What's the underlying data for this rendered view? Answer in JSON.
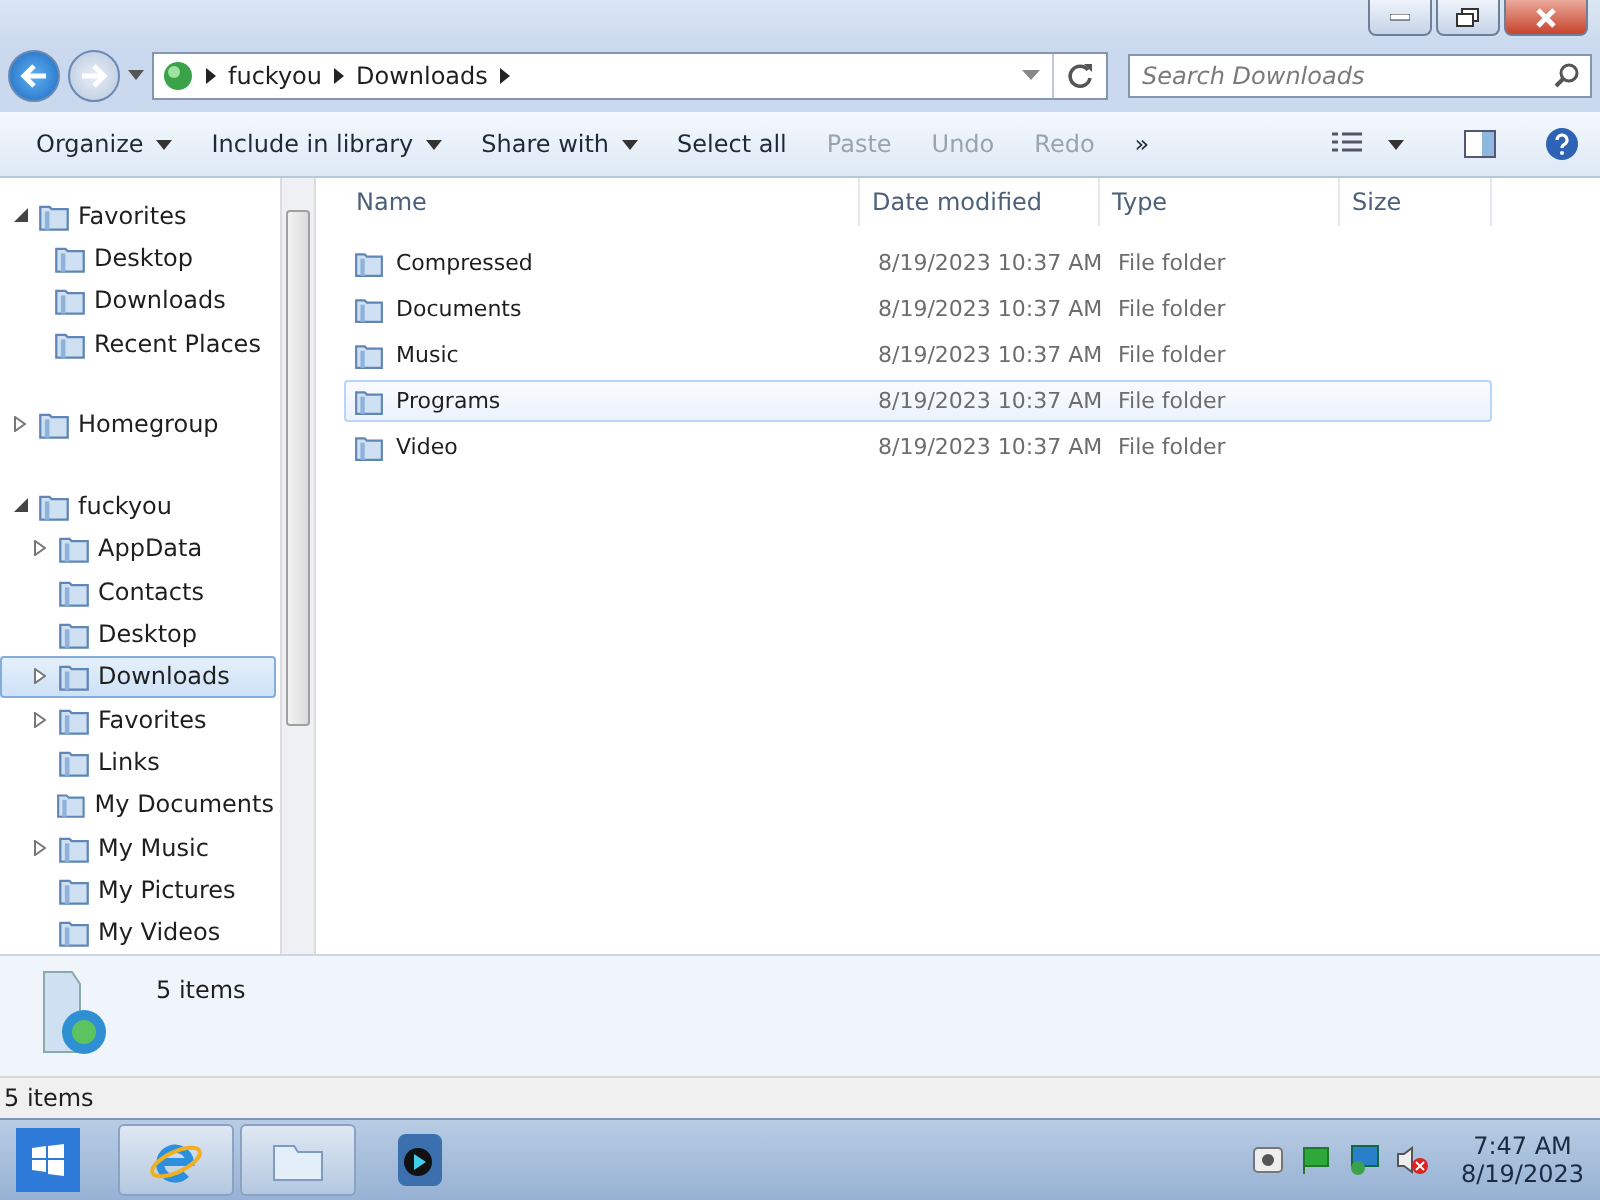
{
  "address_bar": {
    "crumbs": [
      "fuckyou",
      "Downloads"
    ]
  },
  "search": {
    "placeholder": "Search Downloads"
  },
  "toolbar": [
    {
      "label": "Organize",
      "dropdown": true,
      "disabled": false
    },
    {
      "label": "Include in library",
      "dropdown": true,
      "disabled": false
    },
    {
      "label": "Share with",
      "dropdown": true,
      "disabled": false
    },
    {
      "label": "Select all",
      "dropdown": false,
      "disabled": false
    },
    {
      "label": "Paste",
      "dropdown": false,
      "disabled": true
    },
    {
      "label": "Undo",
      "dropdown": false,
      "disabled": true
    },
    {
      "label": "Redo",
      "dropdown": false,
      "disabled": true
    },
    {
      "label": "»",
      "dropdown": false,
      "disabled": false
    }
  ],
  "sidebar": {
    "groups": [
      {
        "label": "Favorites",
        "expanded": true,
        "children": [
          {
            "label": "Desktop"
          },
          {
            "label": "Downloads"
          },
          {
            "label": "Recent Places"
          }
        ]
      },
      {
        "label": "Homegroup",
        "expanded": false
      },
      {
        "label": "fuckyou",
        "expanded": true,
        "children": [
          {
            "label": "AppData",
            "expandable": true,
            "selected": false
          },
          {
            "label": "Contacts",
            "expandable": false,
            "selected": false
          },
          {
            "label": "Desktop",
            "expandable": false,
            "selected": false
          },
          {
            "label": "Downloads",
            "expandable": true,
            "selected": true
          },
          {
            "label": "Favorites",
            "expandable": true,
            "selected": false
          },
          {
            "label": "Links",
            "expandable": false,
            "selected": false
          },
          {
            "label": "My Documents",
            "expandable": false,
            "selected": false
          },
          {
            "label": "My Music",
            "expandable": true,
            "selected": false
          },
          {
            "label": "My Pictures",
            "expandable": false,
            "selected": false
          },
          {
            "label": "My Videos",
            "expandable": false,
            "selected": false
          }
        ]
      }
    ]
  },
  "table": {
    "columns": [
      "Name",
      "Date modified",
      "Type",
      "Size"
    ],
    "rows": [
      {
        "name": "Compressed",
        "date": "8/19/2023 10:37 AM",
        "type": "File folder",
        "hovered": false
      },
      {
        "name": "Documents",
        "date": "8/19/2023 10:37 AM",
        "type": "File folder",
        "hovered": false
      },
      {
        "name": "Music",
        "date": "8/19/2023 10:37 AM",
        "type": "File folder",
        "hovered": false
      },
      {
        "name": "Programs",
        "date": "8/19/2023 10:37 AM",
        "type": "File folder",
        "hovered": true
      },
      {
        "name": "Video",
        "date": "8/19/2023 10:37 AM",
        "type": "File folder",
        "hovered": false
      }
    ]
  },
  "details_pane": {
    "count": "5 items"
  },
  "status_bar": "5 items",
  "taskbar": {
    "time": "7:47 AM",
    "date": "8/19/2023"
  }
}
